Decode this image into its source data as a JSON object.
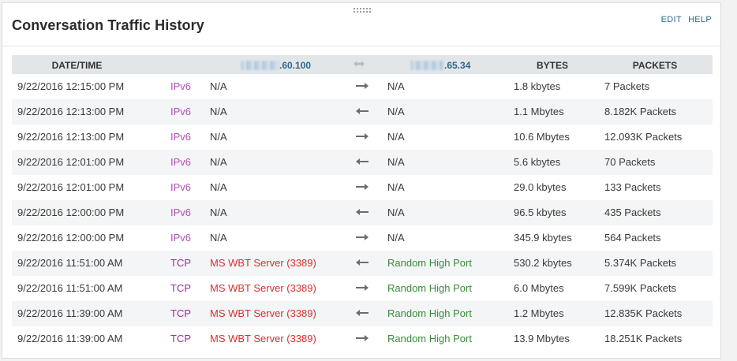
{
  "panel": {
    "title": "Conversation Traffic History",
    "edit_label": "EDIT",
    "help_label": "HELP"
  },
  "colors": {
    "link": "#2f6a8a",
    "ipv6": "#b04fb7",
    "tcp": "#9c2a9e",
    "service_red": "#d63031",
    "service_green": "#3a8a3c",
    "header_bg": "#e3e6e9"
  },
  "table": {
    "headers": {
      "datetime": "DATE/TIME",
      "host_a_suffix": ".60.100",
      "host_b_suffix": ".65.34",
      "bytes": "BYTES",
      "packets": "PACKETS"
    },
    "rows": [
      {
        "datetime": "9/22/2016 12:15:00 PM",
        "protocol": "IPv6",
        "source": "N/A",
        "direction": "right",
        "destination": "N/A",
        "bytes": "1.8 kbytes",
        "packets": "7 Packets"
      },
      {
        "datetime": "9/22/2016 12:13:00 PM",
        "protocol": "IPv6",
        "source": "N/A",
        "direction": "left",
        "destination": "N/A",
        "bytes": "1.1 Mbytes",
        "packets": "8.182K Packets"
      },
      {
        "datetime": "9/22/2016 12:13:00 PM",
        "protocol": "IPv6",
        "source": "N/A",
        "direction": "right",
        "destination": "N/A",
        "bytes": "10.6 Mbytes",
        "packets": "12.093K Packets"
      },
      {
        "datetime": "9/22/2016 12:01:00 PM",
        "protocol": "IPv6",
        "source": "N/A",
        "direction": "left",
        "destination": "N/A",
        "bytes": "5.6 kbytes",
        "packets": "70 Packets"
      },
      {
        "datetime": "9/22/2016 12:01:00 PM",
        "protocol": "IPv6",
        "source": "N/A",
        "direction": "right",
        "destination": "N/A",
        "bytes": "29.0 kbytes",
        "packets": "133 Packets"
      },
      {
        "datetime": "9/22/2016 12:00:00 PM",
        "protocol": "IPv6",
        "source": "N/A",
        "direction": "left",
        "destination": "N/A",
        "bytes": "96.5 kbytes",
        "packets": "435 Packets"
      },
      {
        "datetime": "9/22/2016 12:00:00 PM",
        "protocol": "IPv6",
        "source": "N/A",
        "direction": "right",
        "destination": "N/A",
        "bytes": "345.9 kbytes",
        "packets": "564 Packets"
      },
      {
        "datetime": "9/22/2016 11:51:00 AM",
        "protocol": "TCP",
        "source": "MS WBT Server (3389)",
        "direction": "left",
        "destination": "Random High Port",
        "bytes": "530.2 kbytes",
        "packets": "5.374K Packets"
      },
      {
        "datetime": "9/22/2016 11:51:00 AM",
        "protocol": "TCP",
        "source": "MS WBT Server (3389)",
        "direction": "right",
        "destination": "Random High Port",
        "bytes": "6.0 Mbytes",
        "packets": "7.599K Packets"
      },
      {
        "datetime": "9/22/2016 11:39:00 AM",
        "protocol": "TCP",
        "source": "MS WBT Server (3389)",
        "direction": "left",
        "destination": "Random High Port",
        "bytes": "1.2 Mbytes",
        "packets": "12.835K Packets"
      },
      {
        "datetime": "9/22/2016 11:39:00 AM",
        "protocol": "TCP",
        "source": "MS WBT Server (3389)",
        "direction": "right",
        "destination": "Random High Port",
        "bytes": "13.9 Mbytes",
        "packets": "18.251K Packets"
      }
    ]
  }
}
